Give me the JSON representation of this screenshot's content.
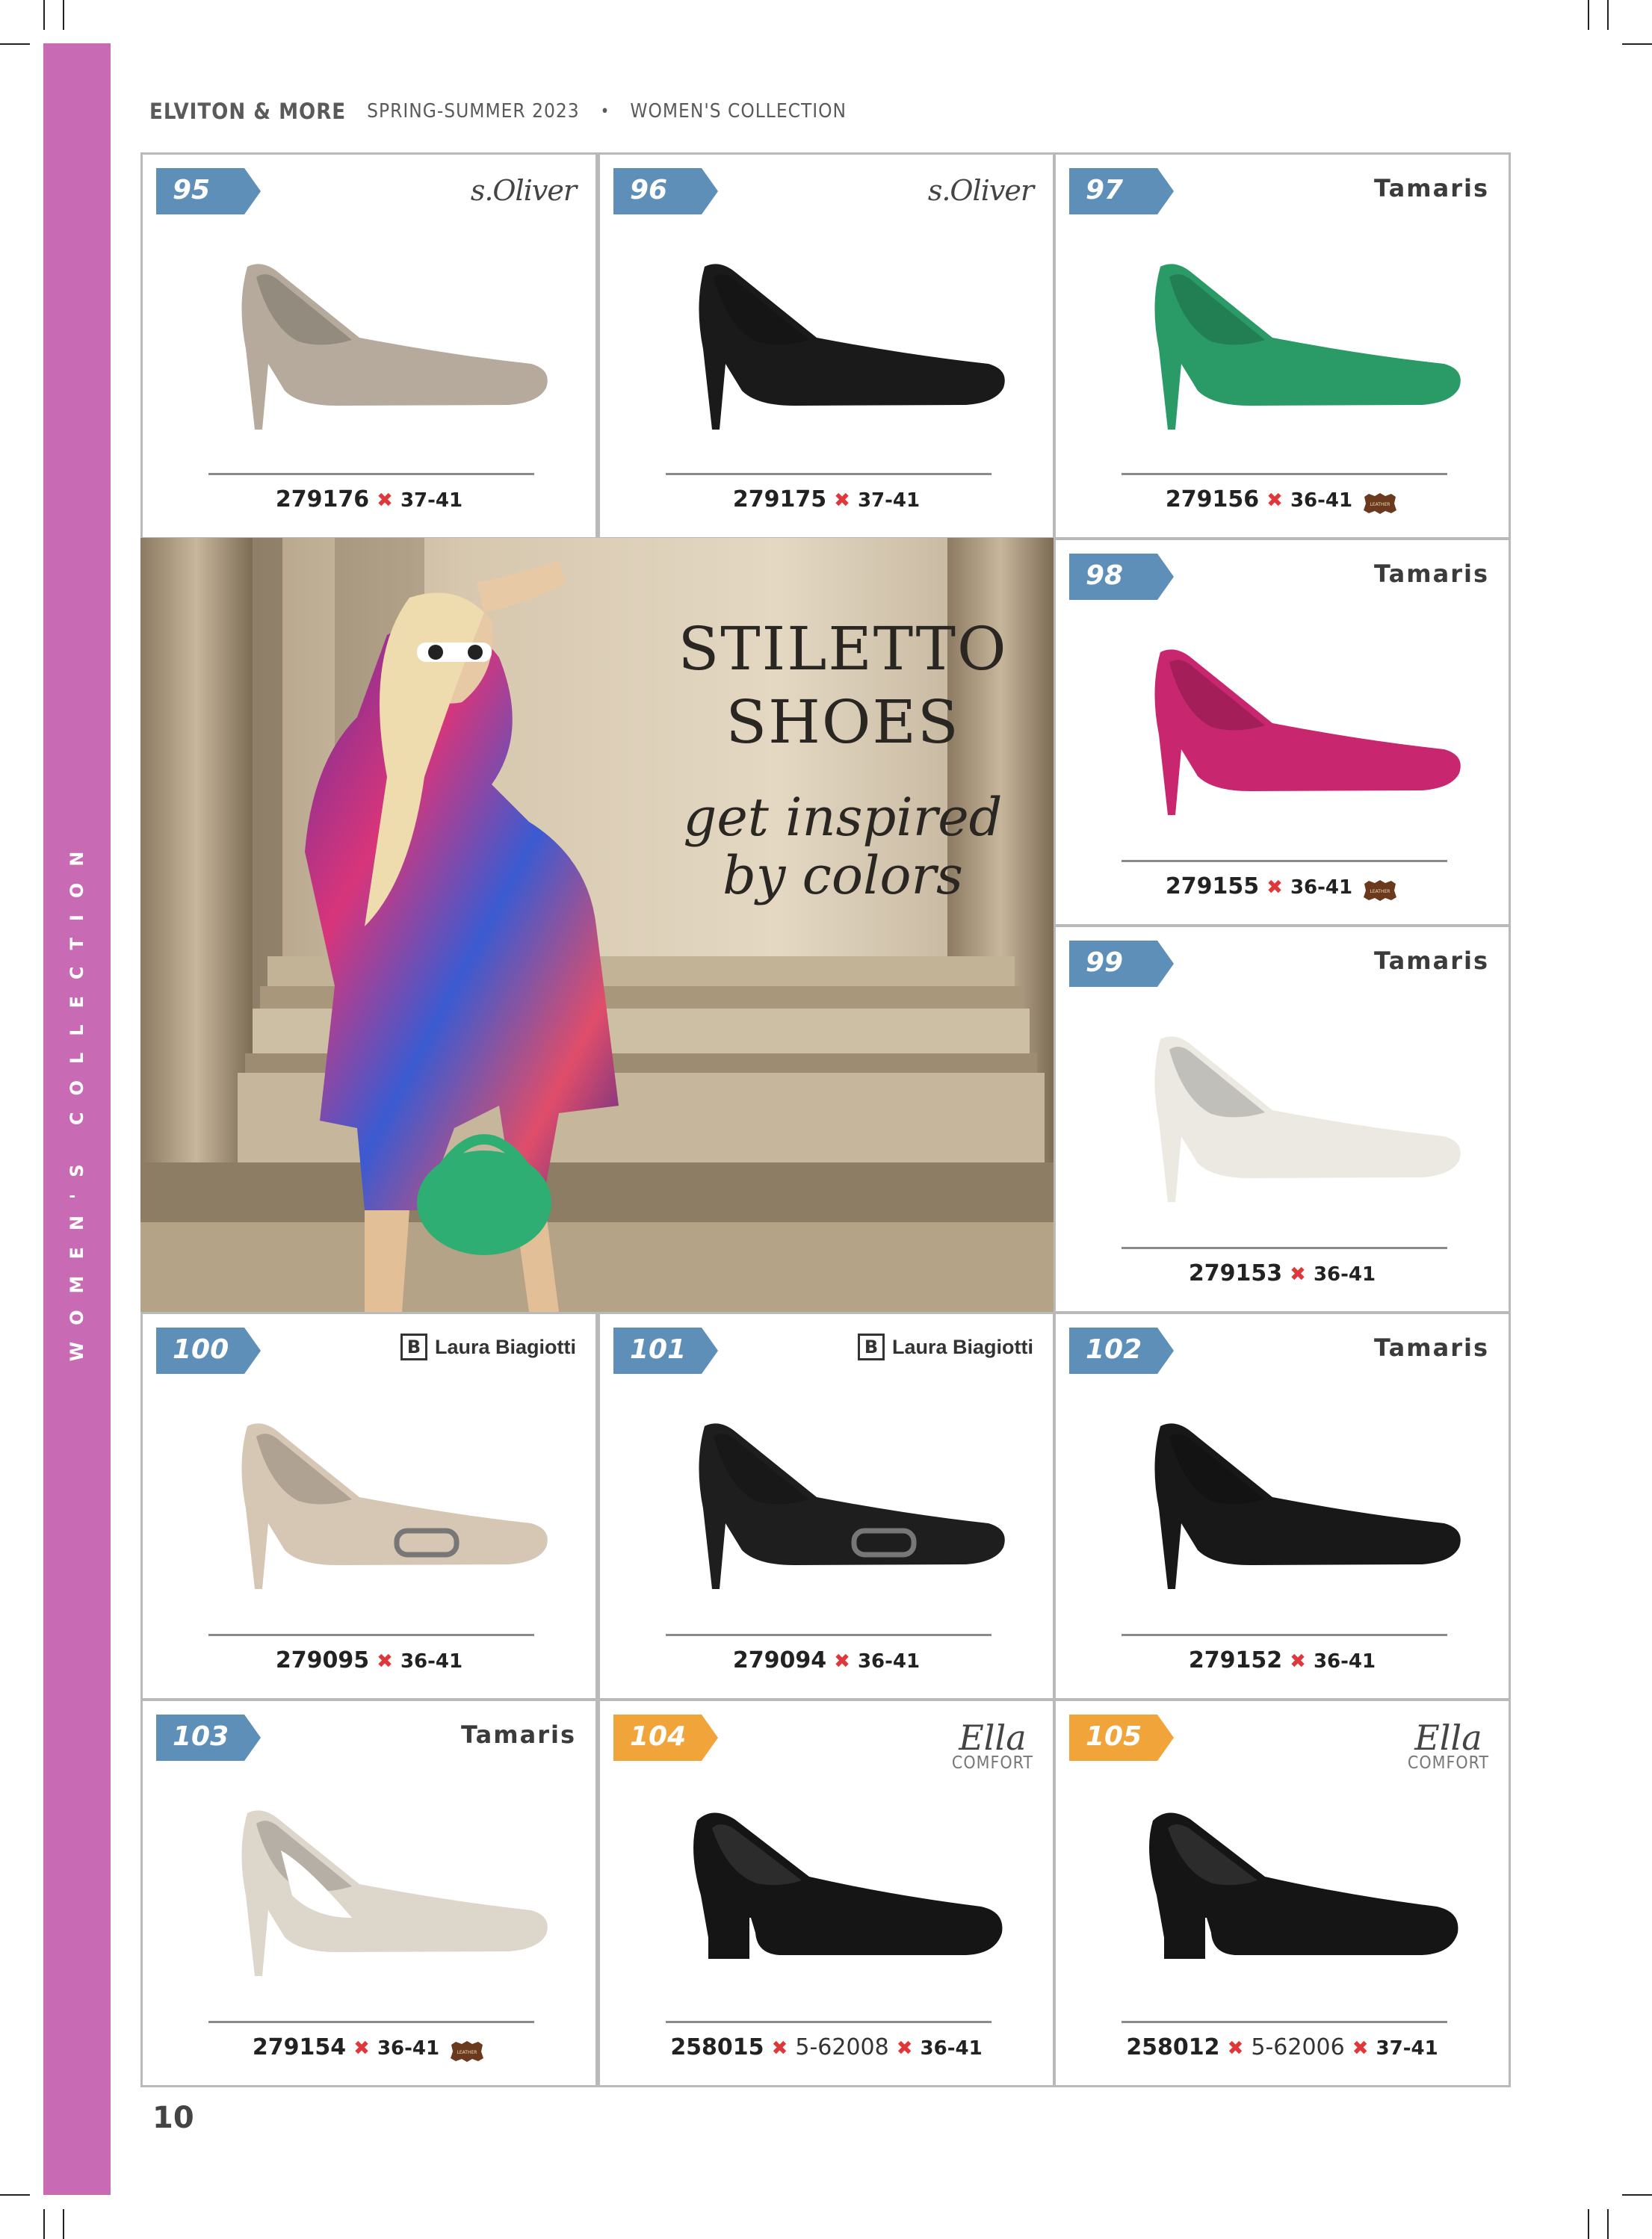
{
  "header": {
    "brand": "ELVITON & MORE",
    "season": "SPRING-SUMMER 2023",
    "separator": "•",
    "collection": "WOMEN'S COLLECTION"
  },
  "sidebar": {
    "text": "WOMEN'S COLLECTION",
    "color": "#c86bb4"
  },
  "hero": {
    "title_line1": "STILETTO",
    "title_line2": "SHOES",
    "subtitle_line1": "get inspired",
    "subtitle_line2": "by colors"
  },
  "products": [
    {
      "number": "95",
      "badge_color": "#5d8fb8",
      "brand": "s.Oliver",
      "logo": "soliver",
      "article": "279176",
      "sizes": "37-41",
      "leather": false,
      "shoe_color": "#b5aa9b",
      "style": "stiletto"
    },
    {
      "number": "96",
      "badge_color": "#5d8fb8",
      "brand": "s.Oliver",
      "logo": "soliver",
      "article": "279175",
      "sizes": "37-41",
      "leather": false,
      "shoe_color": "#1a1a1a",
      "style": "stiletto"
    },
    {
      "number": "97",
      "badge_color": "#5d8fb8",
      "brand": "Tamaris",
      "logo": "tamaris",
      "article": "279156",
      "sizes": "36-41",
      "leather": true,
      "leather_label": "LEATHER",
      "shoe_color": "#2a9a66",
      "style": "stiletto"
    },
    {
      "number": "98",
      "badge_color": "#5d8fb8",
      "brand": "Tamaris",
      "logo": "tamaris",
      "article": "279155",
      "sizes": "36-41",
      "leather": true,
      "leather_label": "LEATHER",
      "shoe_color": "#c8266e",
      "style": "stiletto"
    },
    {
      "number": "99",
      "badge_color": "#5d8fb8",
      "brand": "Tamaris",
      "logo": "tamaris",
      "article": "279153",
      "sizes": "36-41",
      "leather": false,
      "shoe_color": "#ece9e2",
      "style": "stiletto"
    },
    {
      "number": "100",
      "badge_color": "#5d8fb8",
      "brand": "Laura Biagiotti",
      "logo": "laura",
      "article": "279095",
      "sizes": "36-41",
      "leather": false,
      "shoe_color": "#d6c6b4",
      "style": "buckle"
    },
    {
      "number": "101",
      "badge_color": "#5d8fb8",
      "brand": "Laura Biagiotti",
      "logo": "laura",
      "article": "279094",
      "sizes": "36-41",
      "leather": false,
      "shoe_color": "#1e1e1e",
      "style": "buckle"
    },
    {
      "number": "102",
      "badge_color": "#5d8fb8",
      "brand": "Tamaris",
      "logo": "tamaris",
      "article": "279152",
      "sizes": "36-41",
      "leather": false,
      "shoe_color": "#181818",
      "style": "stiletto"
    },
    {
      "number": "103",
      "badge_color": "#5d8fb8",
      "brand": "Tamaris",
      "logo": "tamaris",
      "article": "279154",
      "sizes": "36-41",
      "leather": true,
      "leather_label": "LEATHER",
      "shoe_color": "#ddd6cb",
      "style": "cutout"
    },
    {
      "number": "104",
      "badge_color": "#f1a43a",
      "brand": "Ella Comfort",
      "logo": "ella",
      "logo_line1": "Ella",
      "logo_line2": "COMFORT",
      "article": "258015",
      "alt_code": "5-62008",
      "sizes": "36-41",
      "leather": false,
      "shoe_color": "#151515",
      "style": "block"
    },
    {
      "number": "105",
      "badge_color": "#f1a43a",
      "brand": "Ella Comfort",
      "logo": "ella",
      "logo_line1": "Ella",
      "logo_line2": "COMFORT",
      "article": "258012",
      "alt_code": "5-62006",
      "sizes": "37-41",
      "leather": false,
      "shoe_color": "#151515",
      "style": "block"
    }
  ],
  "page_number": "10"
}
